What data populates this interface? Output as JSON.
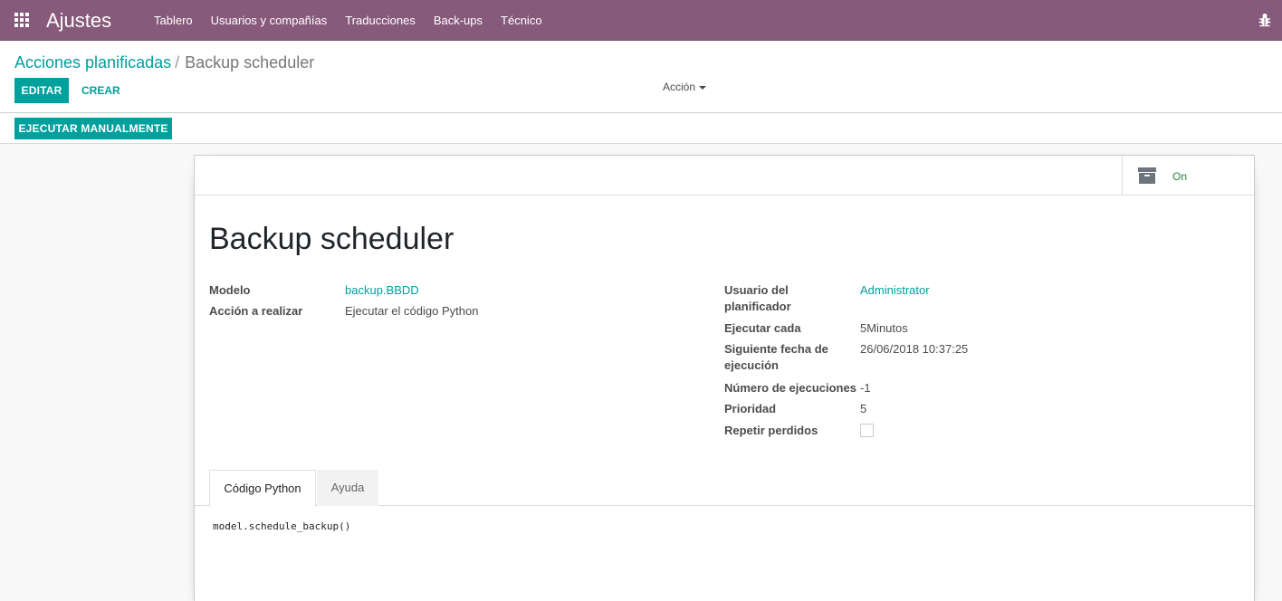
{
  "navbar": {
    "app_title": "Ajustes",
    "menu": [
      "Tablero",
      "Usuarios y compañías",
      "Traducciones",
      "Back-ups",
      "Técnico"
    ],
    "color": "#875a7b",
    "icons": {
      "apps": "apps-grid-icon",
      "debug": "bug-icon"
    }
  },
  "breadcrumb": {
    "parent": "Acciones planificadas",
    "separator": "/",
    "current": "Backup scheduler"
  },
  "buttons": {
    "edit": "EDITAR",
    "create": "CREAR",
    "action": "Acción",
    "run_manually": "EJECUTAR MANUALMENTE"
  },
  "accent_color": "#00a09d",
  "record": {
    "active_label": "On",
    "active_icon": "archive-icon",
    "title": "Backup scheduler",
    "left_fields": [
      {
        "label": "Modelo",
        "value": "backup.BBDD"
      },
      {
        "label": "Acción a realizar",
        "value": "Ejecutar el código Python"
      }
    ],
    "right_fields": [
      {
        "label": "Usuario del planificador",
        "value": "Administrator"
      },
      {
        "label": "Ejecutar cada",
        "value": "5Minutos"
      },
      {
        "label": "Siguiente fecha de ejecución",
        "value": "26/06/2018 10:37:25"
      },
      {
        "label": "Número de ejecuciones",
        "value": "-1"
      },
      {
        "label": "Prioridad",
        "value": "5"
      },
      {
        "label": "Repetir perdidos",
        "value": false
      }
    ]
  },
  "tabs": [
    {
      "label": "Código Python",
      "active": true
    },
    {
      "label": "Ayuda",
      "active": false
    }
  ],
  "code": "model.schedule_backup()"
}
